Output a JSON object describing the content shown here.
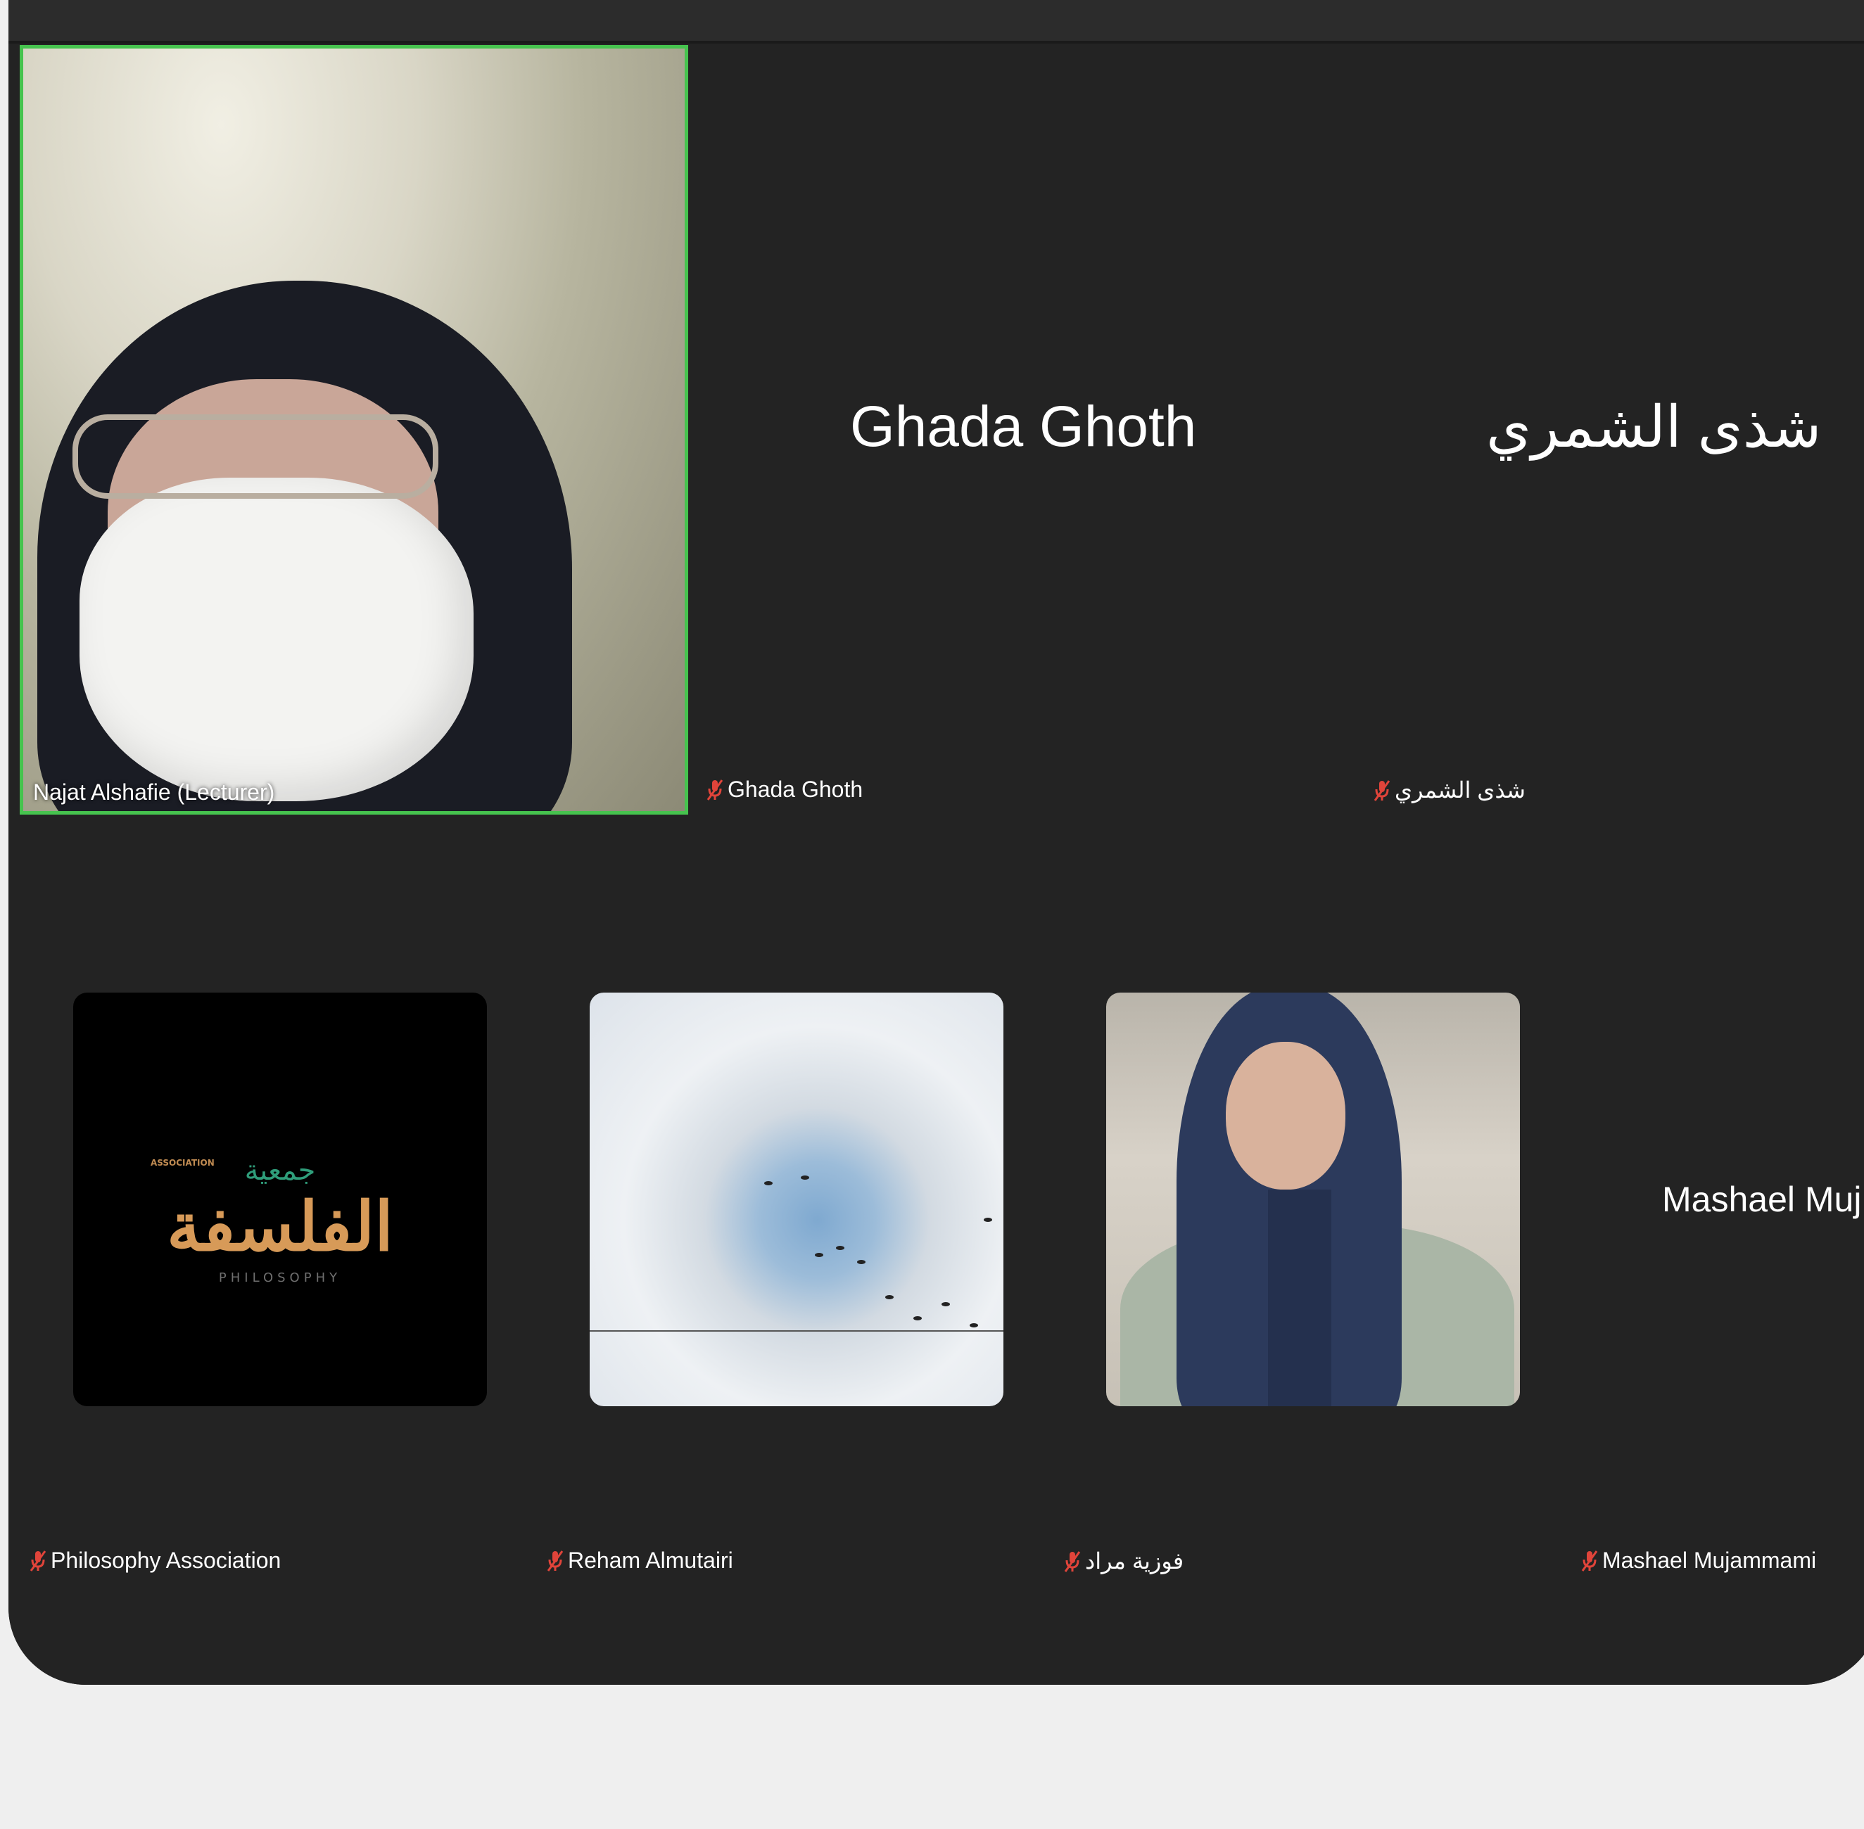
{
  "participants": {
    "speaker": {
      "name": "Najat Alshafie (Lecturer)"
    },
    "ghada": {
      "display": "Ghada Ghoth",
      "label": "Ghada Ghoth"
    },
    "shatha": {
      "display": "شذى الشمري",
      "label": "شذى الشمري"
    },
    "philosophy": {
      "label": "Philosophy Association",
      "logo_top": "جمعية",
      "logo_main": "الفلسفة",
      "logo_left": "ASSOCIATION",
      "logo_sub": "PHILOSOPHY"
    },
    "reham": {
      "label": "Reham Almutairi"
    },
    "fawzia": {
      "label": "فوزية  مراد"
    },
    "mashael": {
      "display": "Mashael Muj",
      "label": "Mashael Mujammami"
    }
  },
  "colors": {
    "active_speaker_border": "#46c34e",
    "muted_icon": "#e0443a",
    "background": "#232323"
  },
  "icons": {
    "muted": "microphone-muted-icon"
  }
}
